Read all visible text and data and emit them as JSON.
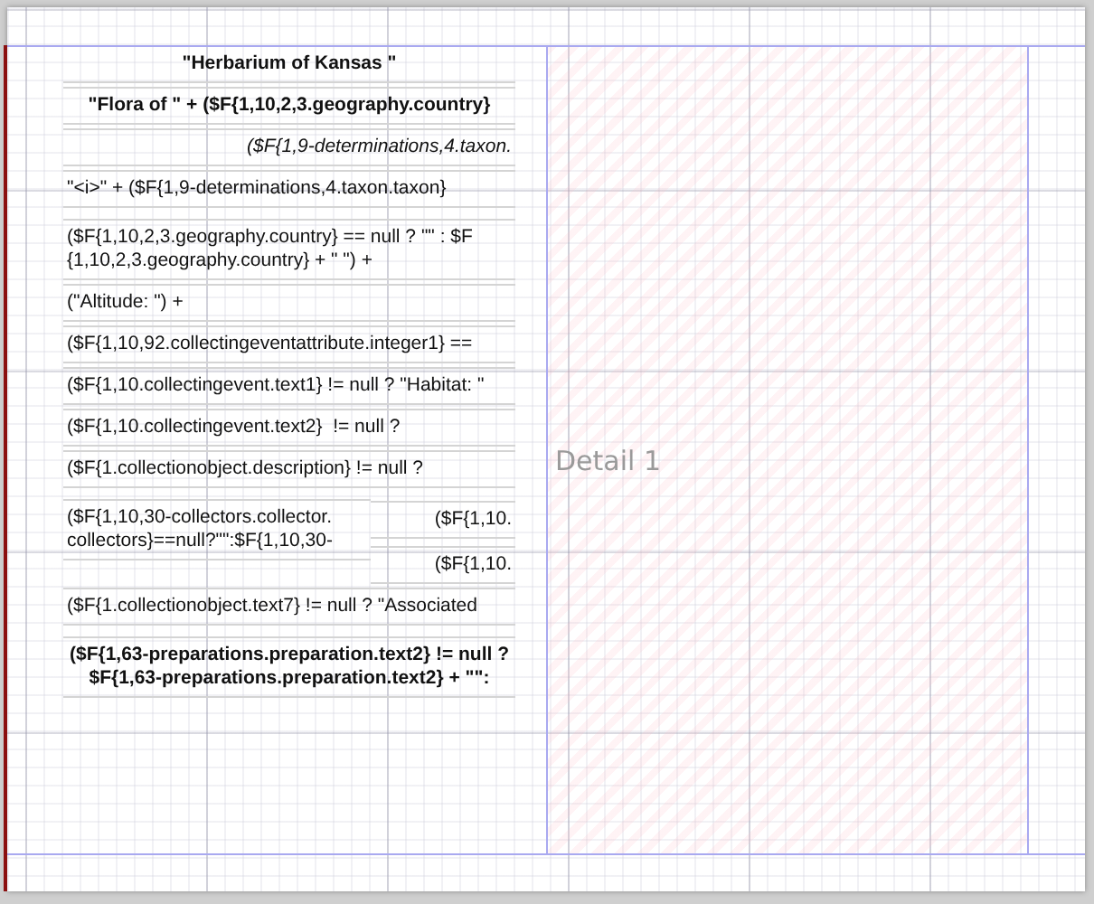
{
  "band": {
    "label": "Detail 1"
  },
  "rows": [
    {
      "fields": [
        {
          "text": "\"Herbarium of Kansas \"",
          "kind": "heading"
        }
      ]
    },
    {
      "fields": [
        {
          "text": "\"Flora of \" + ($F{1,10,2,3.geography.country}",
          "kind": "heading"
        }
      ]
    },
    {
      "fields": [
        {
          "text": "($F{1,9-determinations,4.taxon.",
          "kind": "taxon"
        }
      ]
    },
    {
      "fields": [
        {
          "text": "\"<i>\" + ($F{1,9-determinations,4.taxon.taxon}",
          "kind": "expression"
        }
      ]
    },
    {
      "fields": [
        {
          "text": "($F{1,10,2,3.geography.country} == null ? \"\" : $F {1,10,2,3.geography.country} + \" \") +",
          "kind": "expression"
        }
      ]
    },
    {
      "fields": [
        {
          "text": "(\"Altitude: \") +",
          "kind": "expression"
        }
      ]
    },
    {
      "fields": [
        {
          "text": "($F{1,10,92.collectingeventattribute.integer1} ==",
          "kind": "expression"
        }
      ]
    },
    {
      "fields": [
        {
          "text": "($F{1,10.collectingevent.text1} != null ? \"Habitat: \"",
          "kind": "expression"
        }
      ]
    },
    {
      "fields": [
        {
          "text": "($F{1,10.collectingevent.text2}  != null ?",
          "kind": "expression"
        }
      ]
    },
    {
      "fields": [
        {
          "text": "($F{1.collectionobject.description} != null ?",
          "kind": "expression"
        }
      ]
    },
    {
      "fields": [
        {
          "text": "($F{1,10,30-collectors.collector. collectors}==null?\"\":$F{1,10,30-",
          "kind": "expression"
        }
      ],
      "side": [
        {
          "text": "($F{1,10.",
          "kind": "stub"
        },
        {
          "text": "($F{1,10.",
          "kind": "stub"
        }
      ]
    },
    {
      "fields": [
        {
          "text": "($F{1.collectionobject.text7} != null ? \"Associated",
          "kind": "expression"
        }
      ]
    },
    {
      "fields": [
        {
          "text": "($F{1,63-preparations.preparation.text2} != null ? $F{1,63-preparations.preparation.text2} + \"\":",
          "kind": "heading"
        }
      ]
    }
  ]
}
